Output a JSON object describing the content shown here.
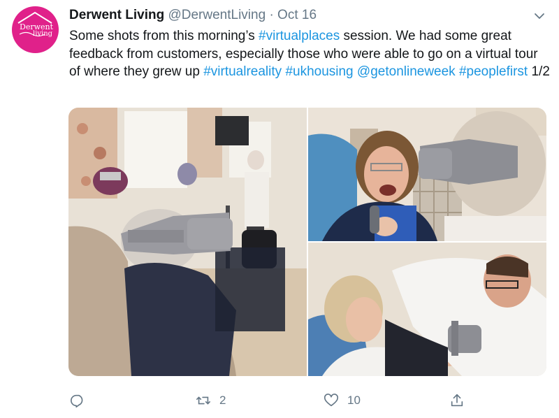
{
  "tweet": {
    "author": {
      "name": "Derwent Living",
      "handle": "@DerwentLiving",
      "avatar_text_1": "Derwent",
      "avatar_text_2": "living",
      "avatar_color": "#e0218a"
    },
    "separator": "·",
    "date": "Oct 16",
    "text_parts": [
      {
        "text": "Some shots from this morning’s ",
        "type": "plain"
      },
      {
        "text": "#virtualplaces",
        "type": "link"
      },
      {
        "text": " session. We had some great feedback from customers, especially those who were able to go on a virtual tour of where they grew up ",
        "type": "plain"
      },
      {
        "text": "#virtualreality",
        "type": "link"
      },
      {
        "text": " ",
        "type": "plain"
      },
      {
        "text": "#ukhousing",
        "type": "link"
      },
      {
        "text": " ",
        "type": "plain"
      },
      {
        "text": "@getonlineweek",
        "type": "link"
      },
      {
        "text": " ",
        "type": "plain"
      },
      {
        "text": "#peoplefirst",
        "type": "link"
      },
      {
        "text": " 1/2",
        "type": "plain"
      }
    ],
    "media": [
      {
        "icon": "photo-vr-lounge"
      },
      {
        "icon": "photo-vr-laughing-woman"
      },
      {
        "icon": "photo-vr-helper-kneeling"
      }
    ],
    "actions": {
      "reply_count": "",
      "retweet_count": "2",
      "like_count": "10"
    },
    "colors": {
      "link": "#1b95e0",
      "muted": "#657786",
      "text": "#14171a"
    }
  }
}
